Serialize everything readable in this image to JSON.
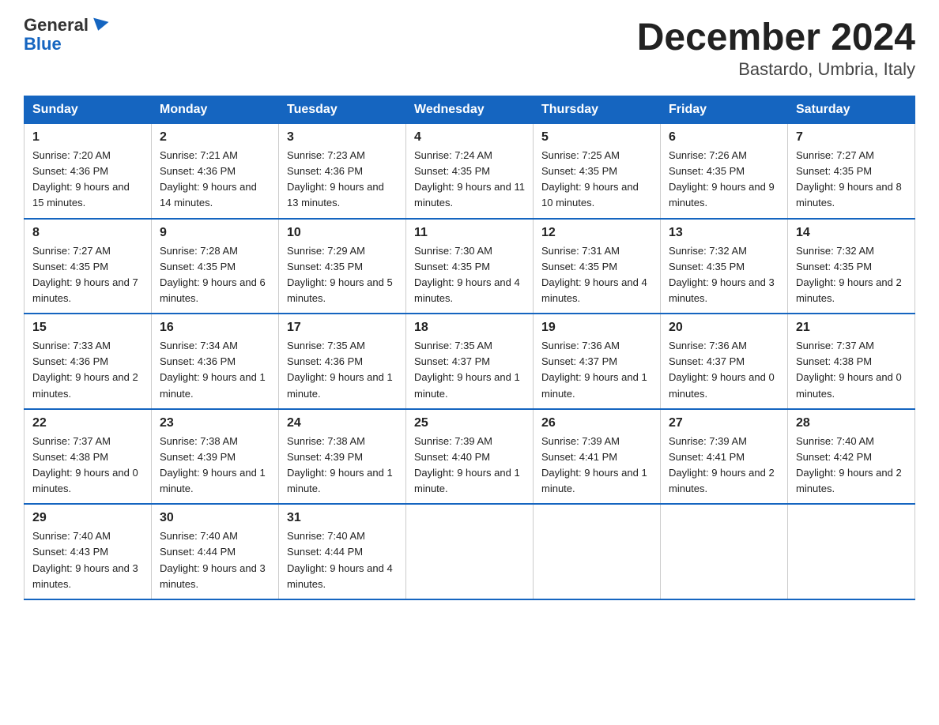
{
  "logo": {
    "line1": "General",
    "line2": "Blue"
  },
  "title": "December 2024",
  "subtitle": "Bastardo, Umbria, Italy",
  "days_of_week": [
    "Sunday",
    "Monday",
    "Tuesday",
    "Wednesday",
    "Thursday",
    "Friday",
    "Saturday"
  ],
  "weeks": [
    [
      {
        "day": "1",
        "sunrise": "7:20 AM",
        "sunset": "4:36 PM",
        "daylight": "9 hours and 15 minutes."
      },
      {
        "day": "2",
        "sunrise": "7:21 AM",
        "sunset": "4:36 PM",
        "daylight": "9 hours and 14 minutes."
      },
      {
        "day": "3",
        "sunrise": "7:23 AM",
        "sunset": "4:36 PM",
        "daylight": "9 hours and 13 minutes."
      },
      {
        "day": "4",
        "sunrise": "7:24 AM",
        "sunset": "4:35 PM",
        "daylight": "9 hours and 11 minutes."
      },
      {
        "day": "5",
        "sunrise": "7:25 AM",
        "sunset": "4:35 PM",
        "daylight": "9 hours and 10 minutes."
      },
      {
        "day": "6",
        "sunrise": "7:26 AM",
        "sunset": "4:35 PM",
        "daylight": "9 hours and 9 minutes."
      },
      {
        "day": "7",
        "sunrise": "7:27 AM",
        "sunset": "4:35 PM",
        "daylight": "9 hours and 8 minutes."
      }
    ],
    [
      {
        "day": "8",
        "sunrise": "7:27 AM",
        "sunset": "4:35 PM",
        "daylight": "9 hours and 7 minutes."
      },
      {
        "day": "9",
        "sunrise": "7:28 AM",
        "sunset": "4:35 PM",
        "daylight": "9 hours and 6 minutes."
      },
      {
        "day": "10",
        "sunrise": "7:29 AM",
        "sunset": "4:35 PM",
        "daylight": "9 hours and 5 minutes."
      },
      {
        "day": "11",
        "sunrise": "7:30 AM",
        "sunset": "4:35 PM",
        "daylight": "9 hours and 4 minutes."
      },
      {
        "day": "12",
        "sunrise": "7:31 AM",
        "sunset": "4:35 PM",
        "daylight": "9 hours and 4 minutes."
      },
      {
        "day": "13",
        "sunrise": "7:32 AM",
        "sunset": "4:35 PM",
        "daylight": "9 hours and 3 minutes."
      },
      {
        "day": "14",
        "sunrise": "7:32 AM",
        "sunset": "4:35 PM",
        "daylight": "9 hours and 2 minutes."
      }
    ],
    [
      {
        "day": "15",
        "sunrise": "7:33 AM",
        "sunset": "4:36 PM",
        "daylight": "9 hours and 2 minutes."
      },
      {
        "day": "16",
        "sunrise": "7:34 AM",
        "sunset": "4:36 PM",
        "daylight": "9 hours and 1 minute."
      },
      {
        "day": "17",
        "sunrise": "7:35 AM",
        "sunset": "4:36 PM",
        "daylight": "9 hours and 1 minute."
      },
      {
        "day": "18",
        "sunrise": "7:35 AM",
        "sunset": "4:37 PM",
        "daylight": "9 hours and 1 minute."
      },
      {
        "day": "19",
        "sunrise": "7:36 AM",
        "sunset": "4:37 PM",
        "daylight": "9 hours and 1 minute."
      },
      {
        "day": "20",
        "sunrise": "7:36 AM",
        "sunset": "4:37 PM",
        "daylight": "9 hours and 0 minutes."
      },
      {
        "day": "21",
        "sunrise": "7:37 AM",
        "sunset": "4:38 PM",
        "daylight": "9 hours and 0 minutes."
      }
    ],
    [
      {
        "day": "22",
        "sunrise": "7:37 AM",
        "sunset": "4:38 PM",
        "daylight": "9 hours and 0 minutes."
      },
      {
        "day": "23",
        "sunrise": "7:38 AM",
        "sunset": "4:39 PM",
        "daylight": "9 hours and 1 minute."
      },
      {
        "day": "24",
        "sunrise": "7:38 AM",
        "sunset": "4:39 PM",
        "daylight": "9 hours and 1 minute."
      },
      {
        "day": "25",
        "sunrise": "7:39 AM",
        "sunset": "4:40 PM",
        "daylight": "9 hours and 1 minute."
      },
      {
        "day": "26",
        "sunrise": "7:39 AM",
        "sunset": "4:41 PM",
        "daylight": "9 hours and 1 minute."
      },
      {
        "day": "27",
        "sunrise": "7:39 AM",
        "sunset": "4:41 PM",
        "daylight": "9 hours and 2 minutes."
      },
      {
        "day": "28",
        "sunrise": "7:40 AM",
        "sunset": "4:42 PM",
        "daylight": "9 hours and 2 minutes."
      }
    ],
    [
      {
        "day": "29",
        "sunrise": "7:40 AM",
        "sunset": "4:43 PM",
        "daylight": "9 hours and 3 minutes."
      },
      {
        "day": "30",
        "sunrise": "7:40 AM",
        "sunset": "4:44 PM",
        "daylight": "9 hours and 3 minutes."
      },
      {
        "day": "31",
        "sunrise": "7:40 AM",
        "sunset": "4:44 PM",
        "daylight": "9 hours and 4 minutes."
      },
      null,
      null,
      null,
      null
    ]
  ]
}
